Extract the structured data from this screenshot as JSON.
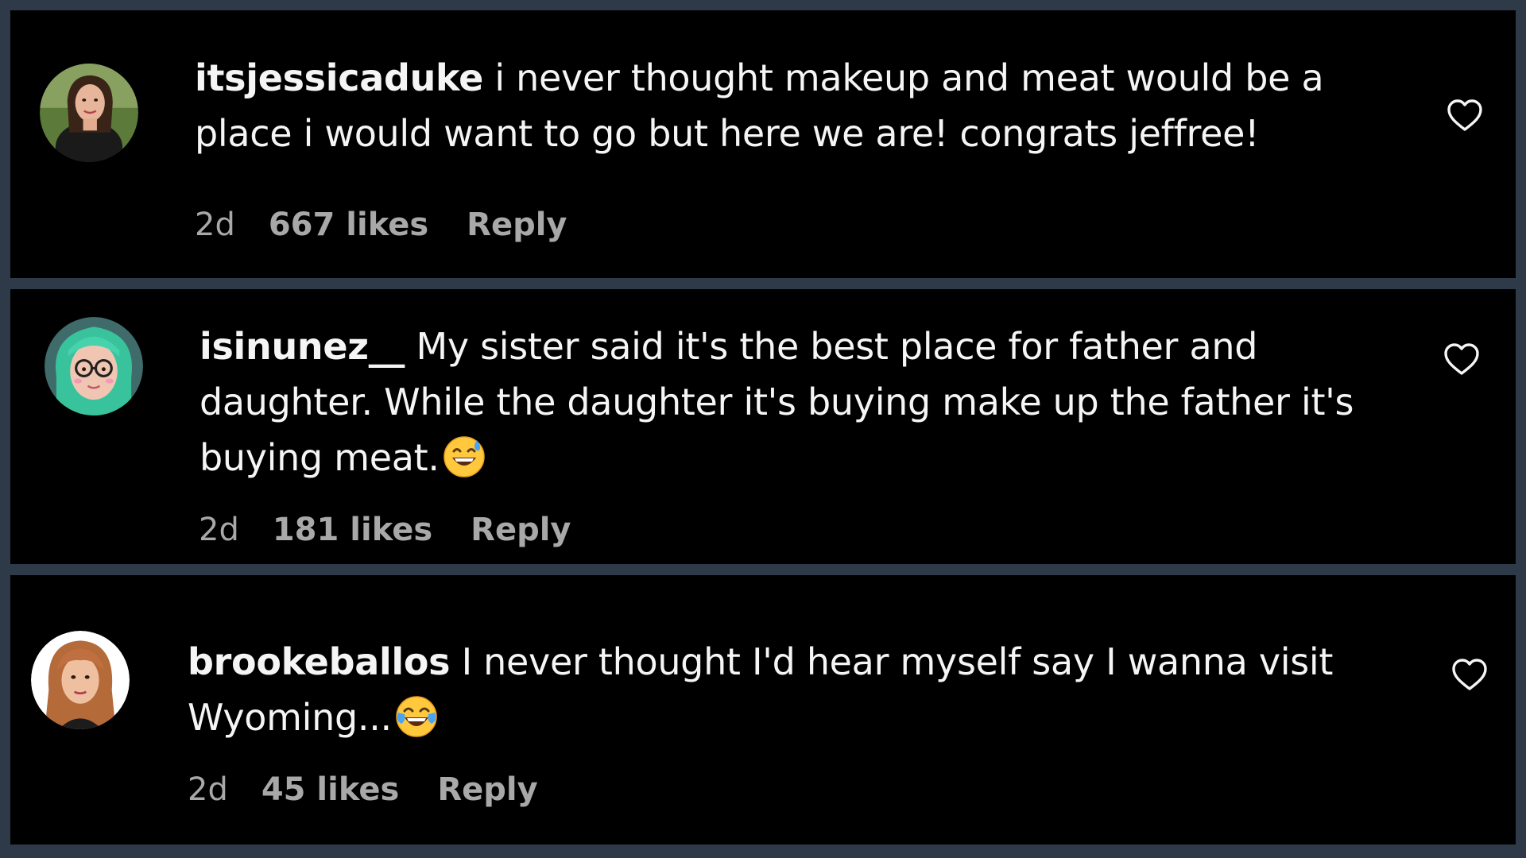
{
  "comments": [
    {
      "username": "itsjessicaduke",
      "text": "i never thought makeup and meat would be a place i would want to go but here we are! congrats jeffree!",
      "time": "2d",
      "likes": "667 likes",
      "reply": "Reply",
      "emoji": ""
    },
    {
      "username": "isinunez__",
      "text": "My sister said it's the best place for father and daughter. While the daughter it's buying make up the father it's buying meat.",
      "time": "2d",
      "likes": "181 likes",
      "reply": "Reply",
      "emoji": "grinning-face-with-sweat"
    },
    {
      "username": "brookeballos",
      "text": "I never thought I'd hear myself say I wanna visit Wyoming...",
      "time": "2d",
      "likes": "45 likes",
      "reply": "Reply",
      "emoji": "face-with-tears-of-joy"
    }
  ],
  "icons": {
    "like": "heart-outline-icon"
  },
  "colors": {
    "background": "#000000",
    "frame": "#2e3a48",
    "text": "#f5f5f5",
    "meta": "#a8a8a8"
  }
}
